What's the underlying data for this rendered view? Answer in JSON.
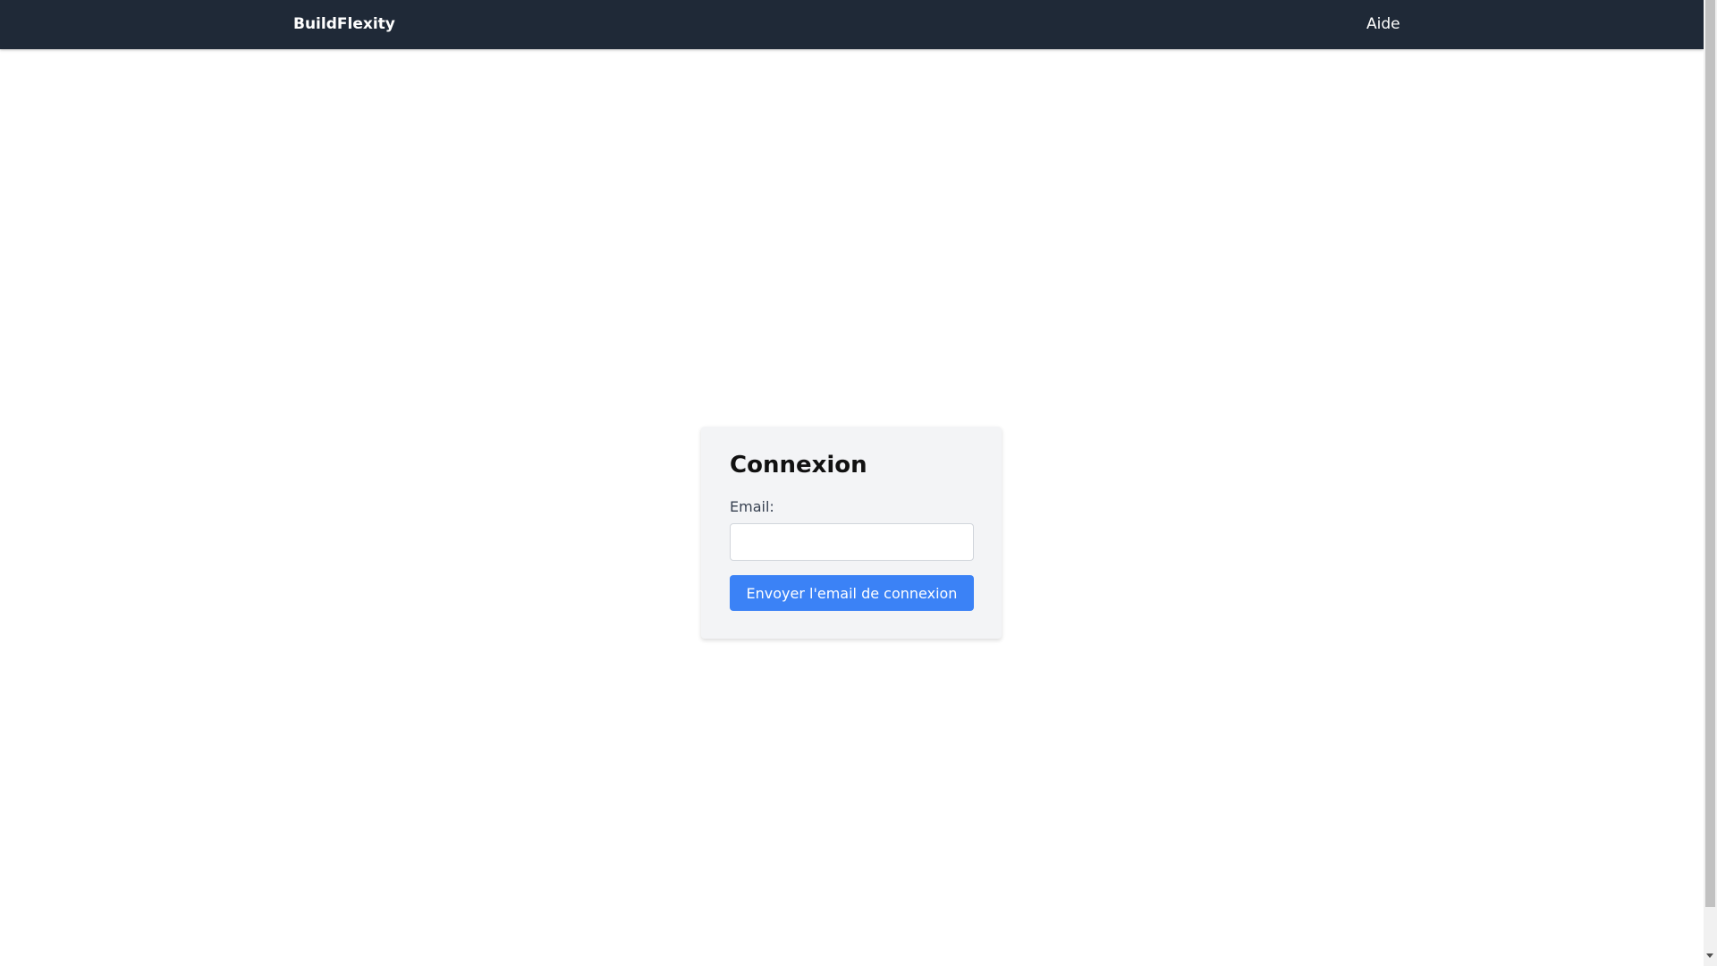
{
  "header": {
    "brand": "BuildFlexity",
    "help_link": "Aide"
  },
  "login": {
    "title": "Connexion",
    "email_label": "Email:",
    "email_value": "",
    "submit_label": "Envoyer l'email de connexion"
  },
  "colors": {
    "header_background": "#1f2937",
    "card_background": "#f3f4f6",
    "button_accent": "#3b82f6"
  },
  "icons": {
    "scroll_down": "chevron-down-icon"
  }
}
